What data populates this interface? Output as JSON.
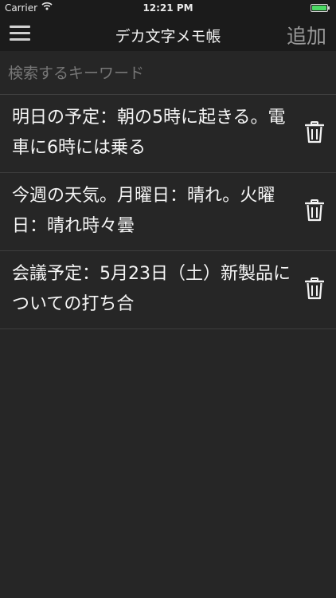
{
  "status_bar": {
    "carrier": "Carrier",
    "time": "12:21 PM",
    "battery_color": "#4cd964"
  },
  "nav": {
    "title": "デカ文字メモ帳",
    "add_label": "追加",
    "menu_icon": "hamburger-menu-icon"
  },
  "search": {
    "placeholder": "検索するキーワード",
    "value": ""
  },
  "memos": [
    {
      "text": "明日の予定：朝の5時に起きる。電車に6時には乗る"
    },
    {
      "text": "今週の天気。月曜日：晴れ。火曜日：晴れ時々曇"
    },
    {
      "text": "会議予定：5月23日（土）新製品についての打ち合"
    }
  ],
  "colors": {
    "background": "#262626",
    "bar": "#1b1b1b",
    "separator": "#3e3e3e",
    "text": "#f5f5f5",
    "add_button": "#9a9a9a",
    "placeholder": "#777777"
  }
}
